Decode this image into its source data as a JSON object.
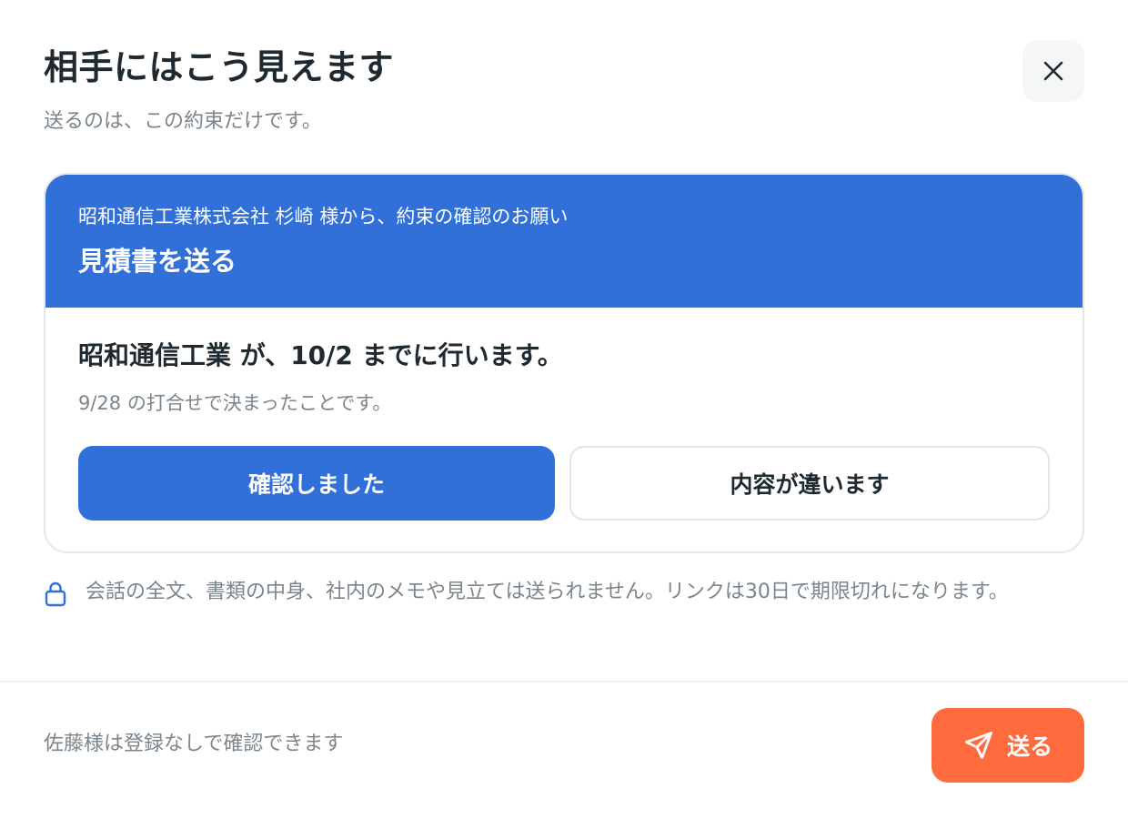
{
  "dialog": {
    "title": "相手にはこう見えます",
    "subtitle": "送るのは、この約束だけです。",
    "close_icon": "close-icon"
  },
  "preview_card": {
    "header": {
      "from_line": "昭和通信工業株式会社 杉崎 様から、約束の確認のお願い",
      "task": "見積書を送る"
    },
    "statement": "昭和通信工業 が、10/2 までに行います。",
    "context": "9/28 の打合せで決まったことです。",
    "confirm_label": "確認しました",
    "different_label": "内容が違います"
  },
  "privacy_notice": {
    "icon": "lock-icon",
    "text": "会話の全文、書類の中身、社内のメモや見立ては送られません。リンクは30日で期限切れになります。"
  },
  "footer": {
    "note": "佐藤様は登録なしで確認できます",
    "send_label": "送る",
    "send_icon": "paper-plane-icon"
  },
  "colors": {
    "primary_blue": "#3170d8",
    "send_orange": "#ff6b3d",
    "text_dark": "#1f2a30",
    "text_muted": "#7b858b"
  }
}
